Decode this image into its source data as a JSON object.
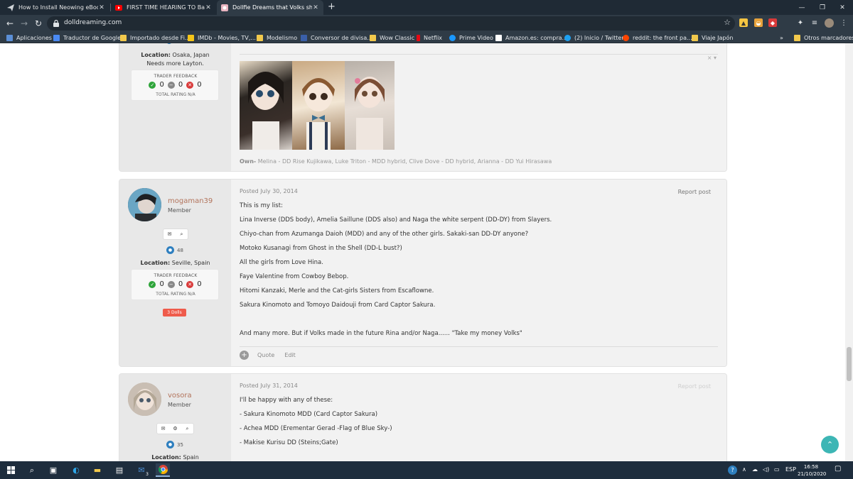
{
  "browser": {
    "tabs": [
      {
        "label": "How to Install Neowing eBook Re",
        "icon": "paper-plane-icon"
      },
      {
        "label": "FIRST TIME HEARING TO Baby M",
        "icon": "youtube-icon"
      },
      {
        "label": "Dollfie Dreams that Volks should",
        "icon": "dolldreaming-icon"
      }
    ],
    "new_tab": "+",
    "url": "dolldreaming.com",
    "bookmarks": [
      {
        "label": "Aplicaciones"
      },
      {
        "label": "Traductor de Google"
      },
      {
        "label": "Importado desde Fi..."
      },
      {
        "label": "IMDb - Movies, TV,..."
      },
      {
        "label": "Modelismo"
      },
      {
        "label": "Conversor de divisa..."
      },
      {
        "label": "Wow Classic"
      },
      {
        "label": "Netflix"
      },
      {
        "label": "Prime Video"
      },
      {
        "label": "Amazon.es: compra..."
      },
      {
        "label": "(2) Inicio / Twitter"
      },
      {
        "label": "reddit: the front pa..."
      },
      {
        "label": "Viaje Japón"
      },
      {
        "label": "Otros marcadores"
      }
    ],
    "more_bookmarks": "»"
  },
  "post1": {
    "location_label": "Location:",
    "location": "Osaka, Japan",
    "custom_line": "Needs more Layton.",
    "feedback_title": "TRADER FEEDBACK",
    "positive": "0",
    "neutral": "0",
    "negative": "0",
    "total": "TOTAL RATING N/A",
    "sig_close": "× ▾",
    "signature_lead": "Own-",
    "signature": " Melina - DD Rise Kujikawa, Luke Triton - MDD hybrid, Clive Dove - DD hybrid, Arianna - DD Yui Hirasawa"
  },
  "post2": {
    "username": "mogaman39",
    "user_title": "Member",
    "message_count": "48",
    "location_label": "Location:",
    "location": "Seville, Spain",
    "feedback_title": "TRADER FEEDBACK",
    "positive": "0",
    "neutral": "0",
    "negative": "0",
    "total": "TOTAL RATING N/A",
    "dolls_badge": "3 Dolls",
    "posted": "Posted July 30, 2014",
    "report": "Report post",
    "lines": [
      "This is my list:",
      "Lina Inverse (DDS body), Amelia Saillune (DDS also) and Naga the white serpent (DD-DY) from Slayers.",
      "Chiyo-chan from Azumanga Daioh (MDD) and any of the other girls. Sakaki-san DD-DY anyone?",
      "Motoko Kusanagi from Ghost in the Shell (DD-L bust?)",
      "All the girls from Love Hina.",
      "Faye Valentine from Cowboy Bebop.",
      "Hitomi Kanzaki, Merle and the Cat-girls Sisters from Escaflowne.",
      "Sakura Kinomoto and Tomoyo Daidouji from Card Captor Sakura.",
      "And many more. But if Volks made in the future Rina and/or Naga...... \"Take my money Volks\""
    ],
    "quote": "Quote",
    "edit": "Edit"
  },
  "post3": {
    "username": "vosora",
    "user_title": "Member",
    "message_count": "35",
    "location_label": "Location:",
    "location": "Spain",
    "posted": "Posted July 31, 2014",
    "report": "Report post",
    "lines": [
      "I'll be happy with any of these:",
      "- Sakura Kinomoto MDD (Card Captor Sakura)",
      "- Achea MDD (Erementar Gerad -Flag of Blue Sky-)",
      "- Makise Kurisu DD (Steins;Gate)"
    ]
  },
  "taskbar": {
    "language": "ESP",
    "time": "16:58",
    "date": "21/10/2020",
    "mail_badge": "3"
  },
  "colors": {
    "username": "#b2735b",
    "badge": "#ef5b4b",
    "fab": "#3db6b5",
    "message_bubble": "#2e7fbf"
  }
}
